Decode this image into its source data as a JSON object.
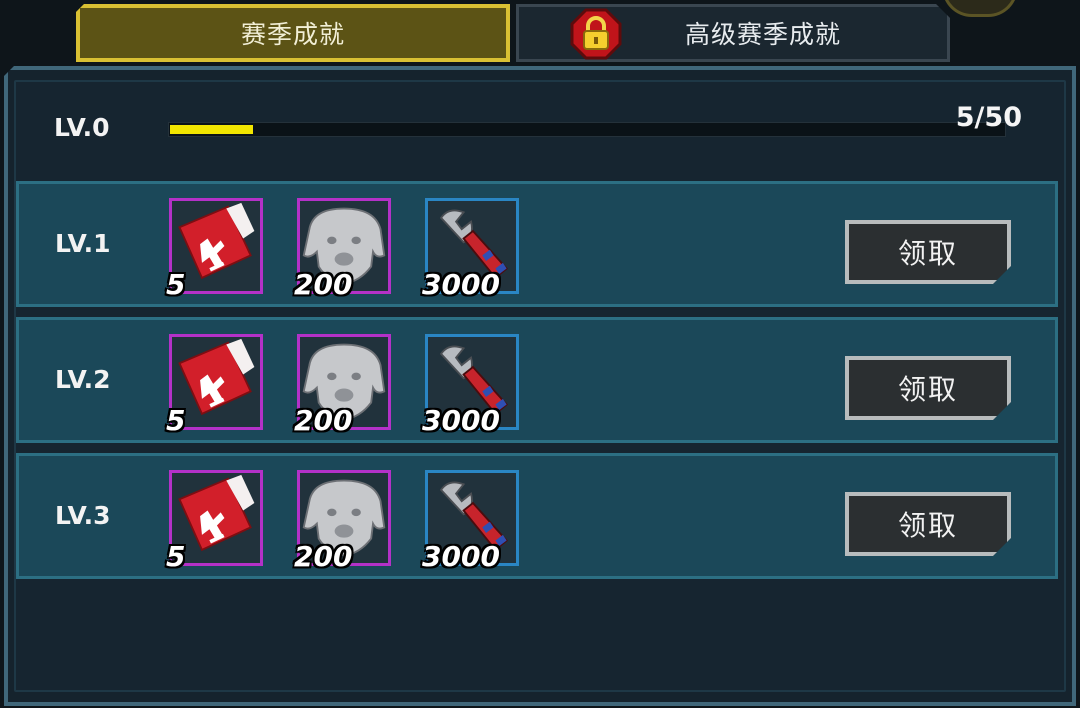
{
  "tabs": [
    {
      "label": "赛季成就",
      "active": true
    },
    {
      "label": "高级赛季成就",
      "active": false,
      "locked": true
    }
  ],
  "progress": {
    "level_label": "LV.0",
    "text": "5/50",
    "current": 5,
    "max": 50,
    "fill_color": "#f2e600"
  },
  "rows": [
    {
      "level": "LV.1",
      "items": [
        {
          "icon": "red-ticket-card-icon",
          "qty": "5",
          "rarity": "purple"
        },
        {
          "icon": "stone-dog-head-icon",
          "qty": "200",
          "rarity": "purple"
        },
        {
          "icon": "wrench-icon",
          "qty": "3000",
          "rarity": "blue"
        }
      ],
      "claim_label": "领取"
    },
    {
      "level": "LV.2",
      "items": [
        {
          "icon": "red-ticket-card-icon",
          "qty": "5",
          "rarity": "purple"
        },
        {
          "icon": "stone-dog-head-icon",
          "qty": "200",
          "rarity": "purple"
        },
        {
          "icon": "wrench-icon",
          "qty": "3000",
          "rarity": "blue"
        }
      ],
      "claim_label": "领取"
    },
    {
      "level": "LV.3",
      "items": [
        {
          "icon": "red-ticket-card-icon",
          "qty": "5",
          "rarity": "purple"
        },
        {
          "icon": "stone-dog-head-icon",
          "qty": "200",
          "rarity": "purple"
        },
        {
          "icon": "wrench-icon",
          "qty": "3000",
          "rarity": "blue"
        }
      ],
      "claim_label": "领取"
    }
  ],
  "colors": {
    "tab_active_border": "#d9c033",
    "row_background": "#1b4859",
    "rarity_purple": "#b431c8",
    "rarity_blue": "#2a86c4"
  }
}
